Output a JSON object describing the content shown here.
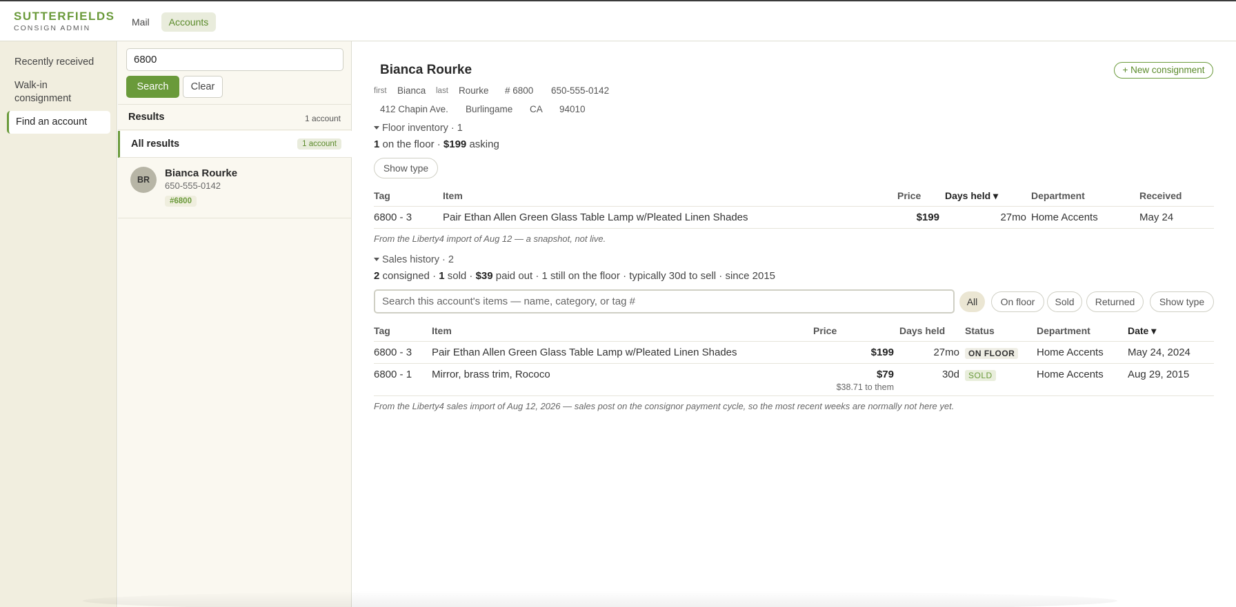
{
  "brand": {
    "name": "SUTTERFIELDS",
    "subtitle": "CONSIGN ADMIN"
  },
  "topnav": {
    "items": [
      {
        "label": "Mail"
      },
      {
        "label": "Accounts",
        "active": true
      }
    ]
  },
  "leftnav": {
    "items": [
      {
        "label": "Recently received"
      },
      {
        "label": "Walk-in consignment"
      },
      {
        "label": "Find an account",
        "active": true
      }
    ]
  },
  "search": {
    "value": "6800",
    "search_label": "Search",
    "clear_label": "Clear"
  },
  "results": {
    "title": "Results",
    "count": "1 account",
    "all_label": "All results",
    "all_count": "1 account",
    "items": [
      {
        "initials": "BR",
        "name": "Bianca Rourke",
        "phone": "650-555-0142",
        "tag": "#6800"
      }
    ]
  },
  "account": {
    "name": "Bianca Rourke",
    "new_button": "+ New consignment",
    "first_label": "first",
    "first": "Bianca",
    "last_label": "last",
    "last": "Rourke",
    "number": "# 6800",
    "phone": "650-555-0142",
    "address": "412 Chapin Ave.",
    "city": "Burlingame",
    "state": "CA",
    "zip": "94010"
  },
  "floor": {
    "title": "Floor inventory · 1",
    "summary": {
      "count": "1",
      "count_text": " on the floor · ",
      "asking": "$199",
      "asking_text": " asking"
    },
    "show_type": "Show type",
    "headers": {
      "tag": "Tag",
      "item": "Item",
      "price": "Price",
      "days": "Days held ▾",
      "dept": "Department",
      "received": "Received"
    },
    "rows": [
      {
        "tag": "6800 - 3",
        "item": "Pair Ethan Allen Green Glass Table Lamp w/Pleated Linen Shades",
        "price": "$199",
        "days": "27mo",
        "dept": "Home Accents",
        "received": "May 24"
      }
    ],
    "note": "From the Liberty4 import of Aug 12 — a snapshot, not live."
  },
  "sales": {
    "title": "Sales history · 2",
    "summary": {
      "consigned": "2",
      "consigned_text": " consigned · ",
      "sold": "1",
      "sold_text": " sold · ",
      "paid": "$39",
      "rest": " paid out · 1 still on the floor · typically 30d to sell · since 2015"
    },
    "search_placeholder": "Search this account's items — name, category, or tag #",
    "filters": [
      {
        "label": "All",
        "active": true
      },
      {
        "label": "On floor"
      },
      {
        "label": "Sold"
      },
      {
        "label": "Returned"
      }
    ],
    "show_type": "Show type",
    "headers": {
      "tag": "Tag",
      "item": "Item",
      "price": "Price",
      "days": "Days held",
      "status": "Status",
      "dept": "Department",
      "date": "Date ▾"
    },
    "rows": [
      {
        "tag": "6800 - 3",
        "item": "Pair Ethan Allen Green Glass Table Lamp w/Pleated Linen Shades",
        "price": "$199",
        "sub": "",
        "days": "27mo",
        "status": "ON FLOOR",
        "dept": "Home Accents",
        "date": "May 24, 2024"
      },
      {
        "tag": "6800 - 1",
        "item": "Mirror, brass trim, Rococo",
        "price": "$79",
        "sub": "$38.71 to them",
        "days": "30d",
        "status": "SOLD",
        "dept": "Home Accents",
        "date": "Aug 29, 2015"
      }
    ],
    "note": "From the Liberty4 sales import of Aug 12, 2026 — sales post on the consignor payment cycle, so the most recent weeks are normally not here yet."
  },
  "colors": {
    "accent": "#6a9a3a",
    "sidebar_bg": "#f1eedf",
    "panel_bg": "#faf8f0"
  }
}
